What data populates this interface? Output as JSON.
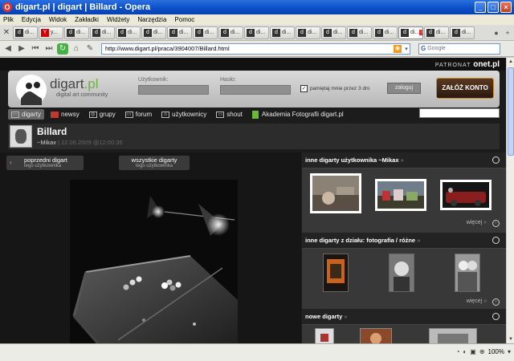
{
  "window": {
    "title": "digart.pl | digart | Billard - Opera",
    "app_icon": "O",
    "buttons": [
      "_",
      "□",
      "×"
    ]
  },
  "menu": [
    "Plik",
    "Edycja",
    "Widok",
    "Zakładki",
    "Widżety",
    "Narzędzia",
    "Pomoc"
  ],
  "tabs": [
    {
      "label": "di...",
      "fav": "d"
    },
    {
      "label": "y...",
      "fav": "Y"
    },
    {
      "label": "di...",
      "fav": "d"
    },
    {
      "label": "di...",
      "fav": "d"
    },
    {
      "label": "di...",
      "fav": "d"
    },
    {
      "label": "di...",
      "fav": "d"
    },
    {
      "label": "di...",
      "fav": "d"
    },
    {
      "label": "di...",
      "fav": "d"
    },
    {
      "label": "di...",
      "fav": "d"
    },
    {
      "label": "di...",
      "fav": "d"
    },
    {
      "label": "di...",
      "fav": "d"
    },
    {
      "label": "di...",
      "fav": "d"
    },
    {
      "label": "di...",
      "fav": "d"
    },
    {
      "label": "di...",
      "fav": "d"
    },
    {
      "label": "di...",
      "fav": "d"
    },
    {
      "label": "di...",
      "fav": "d",
      "active": true
    },
    {
      "label": "di...",
      "fav": "d"
    },
    {
      "label": "di...",
      "fav": "d"
    }
  ],
  "address": {
    "url": "http://www.digart.pl/praca/3904007/Billard.html",
    "search_placeholder": "Google",
    "search_brand": "G"
  },
  "site": {
    "patronat_label": "PATRONAT",
    "patronat_brand": "onet.pl",
    "logo_main": "digart",
    "logo_tld": ".pl",
    "logo_sub": "digital art community",
    "login_label": "Użytkownik:",
    "password_label": "Hasło:",
    "remember_label": "pamiętaj mnie przez 3 dni",
    "remember_checked": "✓",
    "login_button": "zaloguj",
    "signup_button": "ZAŁÓŻ KONTO"
  },
  "nav": [
    {
      "label": "digarty",
      "active": true
    },
    {
      "label": "newsy"
    },
    {
      "label": "grupy"
    },
    {
      "label": "forum"
    },
    {
      "label": "użytkownicy"
    },
    {
      "label": "shout"
    },
    {
      "label": "Akademia Fotografii digart.pl"
    }
  ],
  "work": {
    "title": "Billard",
    "author": "~Mikax",
    "date": "22.06.2009 @12:00:35",
    "separator": "|"
  },
  "buttons": {
    "prev_line1": "poprzedni digart",
    "prev_line2": "tego użytkownika",
    "prev_arrow": "‹",
    "all_line1": "wszystkie digarty",
    "all_line2": "tego użytkownika"
  },
  "sidebar": {
    "section1_title": "inne digarty użytkownika ~Mikax",
    "section2_title": "inne digarty z działu: fotografia / różne",
    "section3_title": "nowe digarty",
    "raquo": "»",
    "more_label": "więcej"
  },
  "status": {
    "zoom": "100%"
  }
}
